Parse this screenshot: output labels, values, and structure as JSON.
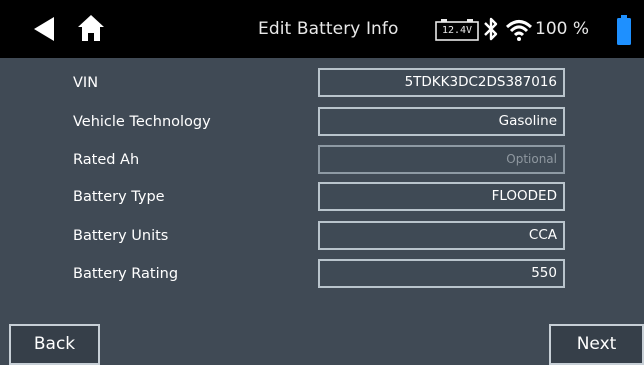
{
  "header": {
    "title": "Edit Battery Info",
    "voltage_label": "12.4V",
    "battery_percent": "100 %",
    "icons": [
      "back-icon",
      "home-icon",
      "battery-voltage-icon",
      "bluetooth-icon",
      "wifi-icon",
      "battery-level-icon"
    ],
    "colors": {
      "bar": "#000000",
      "battery": "#1e90ff",
      "text": "#e8e8e8"
    }
  },
  "form": {
    "rows": [
      {
        "label": "VIN",
        "value": "5TDKK3DC2DS387016",
        "placeholder": ""
      },
      {
        "label": "Vehicle Technology",
        "value": "Gasoline",
        "placeholder": ""
      },
      {
        "label": "Rated Ah",
        "value": "",
        "placeholder": "Optional"
      },
      {
        "label": "Battery Type",
        "value": "FLOODED",
        "placeholder": ""
      },
      {
        "label": "Battery Units",
        "value": "CCA",
        "placeholder": ""
      },
      {
        "label": "Battery Rating",
        "value": "550",
        "placeholder": ""
      }
    ]
  },
  "footer": {
    "back_label": "Back",
    "next_label": "Next"
  },
  "colors": {
    "background": "#404a55",
    "field_border": "#b9c4cc",
    "button_border": "#c7cfd6"
  }
}
